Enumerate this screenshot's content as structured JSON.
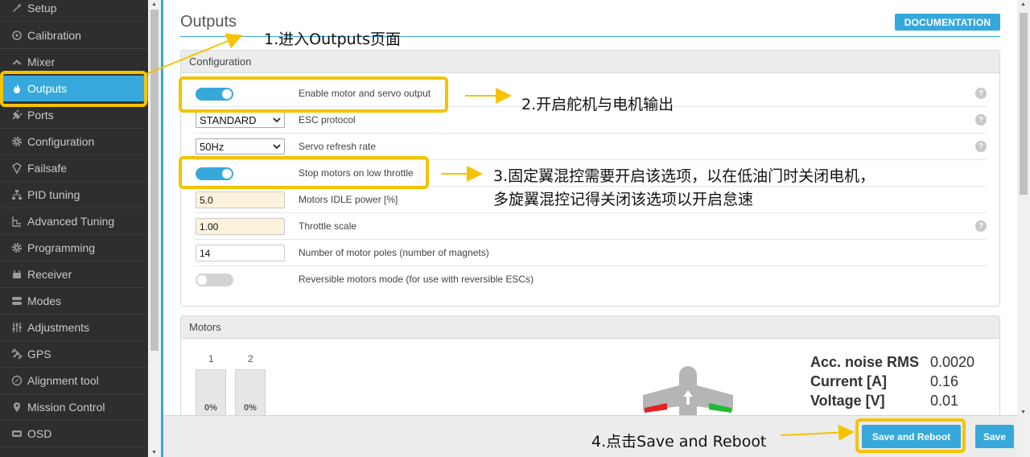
{
  "sidebar": {
    "items": [
      {
        "label": "Setup",
        "icon": "wrench-icon"
      },
      {
        "label": "Calibration",
        "icon": "crosshair-icon"
      },
      {
        "label": "Mixer",
        "icon": "mixer-icon"
      },
      {
        "label": "Outputs",
        "icon": "flame-icon"
      },
      {
        "label": "Ports",
        "icon": "plug-icon"
      },
      {
        "label": "Configuration",
        "icon": "gear-icon"
      },
      {
        "label": "Failsafe",
        "icon": "shield-icon"
      },
      {
        "label": "PID tuning",
        "icon": "sitemap-icon"
      },
      {
        "label": "Advanced Tuning",
        "icon": "advanced-icon"
      },
      {
        "label": "Programming",
        "icon": "gear-icon"
      },
      {
        "label": "Receiver",
        "icon": "receiver-icon"
      },
      {
        "label": "Modes",
        "icon": "toggle-icon"
      },
      {
        "label": "Adjustments",
        "icon": "sliders-icon"
      },
      {
        "label": "GPS",
        "icon": "satellite-icon"
      },
      {
        "label": "Alignment tool",
        "icon": "compass-icon"
      },
      {
        "label": "Mission Control",
        "icon": "map-marker-icon"
      },
      {
        "label": "OSD",
        "icon": "osd-icon"
      }
    ],
    "active": "Outputs"
  },
  "page": {
    "title": "Outputs",
    "documentation_label": "DOCUMENTATION"
  },
  "configuration": {
    "title": "Configuration",
    "enable_motor_servo": {
      "label": "Enable motor and servo output",
      "on": true
    },
    "esc_protocol": {
      "label": "ESC protocol",
      "value": "STANDARD"
    },
    "servo_refresh": {
      "label": "Servo refresh rate",
      "value": "50Hz"
    },
    "stop_motors": {
      "label": "Stop motors on low throttle",
      "on": true
    },
    "idle_power": {
      "label": "Motors IDLE power [%]",
      "value": "5.0"
    },
    "throttle_scale": {
      "label": "Throttle scale",
      "value": "1.00"
    },
    "motor_poles": {
      "label": "Number of motor poles (number of magnets)",
      "value": "14"
    },
    "reversible": {
      "label": "Reversible motors mode (for use with reversible ESCs)",
      "on": false
    },
    "help_glyph": "?"
  },
  "motors": {
    "title": "Motors",
    "numbers": [
      "1",
      "2"
    ],
    "values": [
      "0%",
      "0%"
    ],
    "stats": [
      {
        "label": "Acc. noise RMS",
        "value": "0.0020"
      },
      {
        "label": "Current [A]",
        "value": "0.16"
      },
      {
        "label": "Voltage [V]",
        "value": "0.01"
      }
    ]
  },
  "footer": {
    "save_reboot_label": "Save and Reboot",
    "save_label": "Save"
  },
  "annotations": {
    "step1": "1.进入Outputs页面",
    "step2": "2.开启舵机与电机输出",
    "step3_line1": "3.固定翼混控需要开启该选项，以在低油门时关闭电机，",
    "step3_line2": "多旋翼混控记得关闭该选项以开启怠速",
    "step4": "4.点击Save and Reboot"
  },
  "colors": {
    "accent": "#37a8db",
    "highlight": "#f5c300",
    "sidebar_bg": "#2e2e2e"
  }
}
